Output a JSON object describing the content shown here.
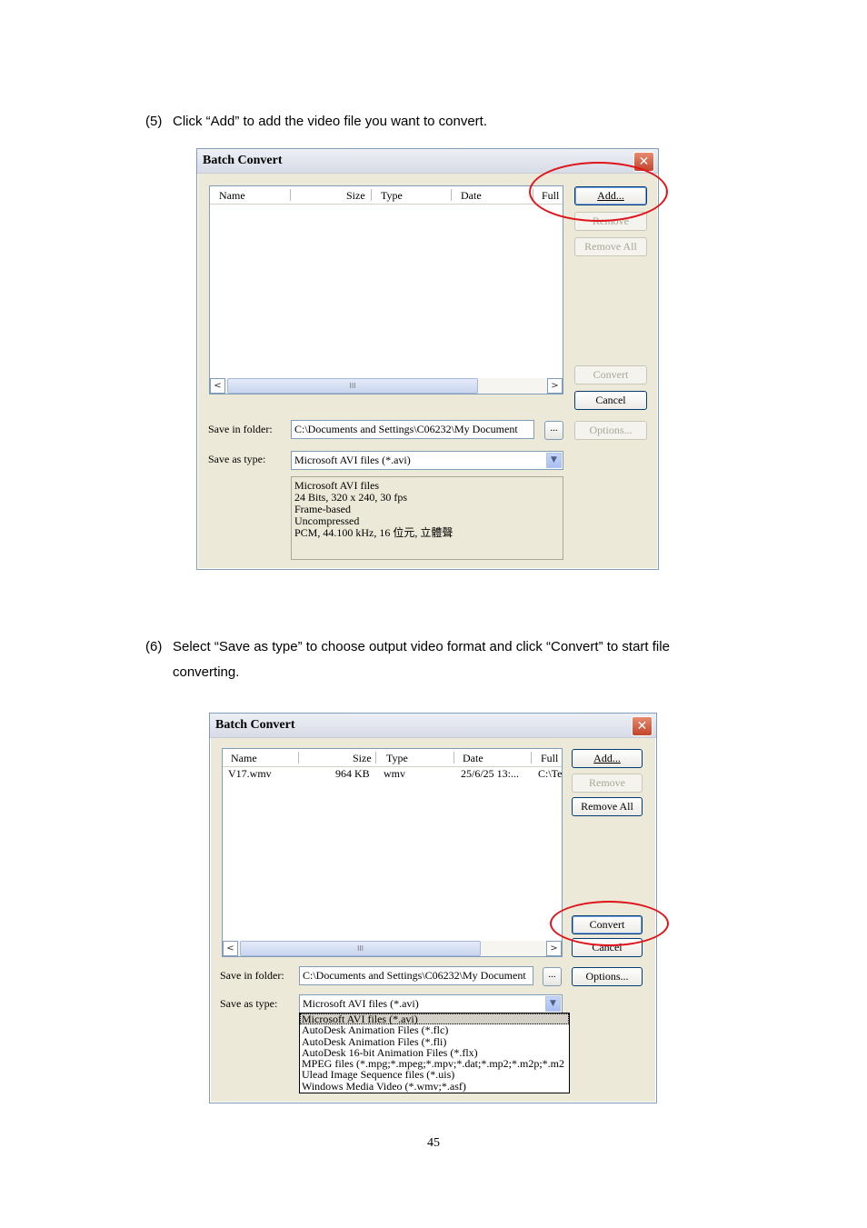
{
  "step5": {
    "number": "(5)",
    "text": "Click “Add” to add the video file you want to convert."
  },
  "step6": {
    "number": "(6)",
    "line1": "Select “Save as type” to choose output video format and click “Convert” to start file",
    "line2": "converting."
  },
  "dialog1": {
    "title": "Batch Convert",
    "columns": [
      "Name",
      "Size",
      "Type",
      "Date",
      "Full"
    ],
    "buttons": {
      "add": "Add...",
      "remove": "Remove",
      "remove_all": "Remove All",
      "convert": "Convert",
      "cancel": "Cancel",
      "options": "Options..."
    },
    "save_in_folder_label": "Save in folder:",
    "save_in_folder_value": "C:\\Documents and Settings\\C06232\\My Document",
    "save_as_type_label": "Save as type:",
    "save_as_type_value": "Microsoft AVI files (*.avi)",
    "info": [
      "Microsoft AVI files",
      "24 Bits, 320 x 240, 30 fps",
      "Frame-based",
      "Uncompressed",
      "PCM, 44.100 kHz, 16 位元, 立體聲"
    ],
    "browse_label": "...",
    "scroll_grip": "III"
  },
  "dialog2": {
    "title": "Batch Convert",
    "columns": [
      "Name",
      "Size",
      "Type",
      "Date",
      "Full"
    ],
    "row": {
      "name": "V17.wmv",
      "size": "964 KB",
      "type": "wmv",
      "date": "25/6/25 13:...",
      "full": "C:\\Te"
    },
    "buttons": {
      "add": "Add...",
      "remove": "Remove",
      "remove_all": "Remove All",
      "convert": "Convert",
      "cancel": "Cancel",
      "options": "Options..."
    },
    "save_in_folder_label": "Save in folder:",
    "save_in_folder_value": "C:\\Documents and Settings\\C06232\\My Document",
    "save_as_type_label": "Save as type:",
    "save_as_type_value": "Microsoft AVI files (*.avi)",
    "dropdown_options": [
      "Microsoft AVI files (*.avi)",
      "AutoDesk Animation Files (*.flc)",
      "AutoDesk Animation Files (*.fli)",
      "AutoDesk 16-bit Animation Files (*.flx)",
      "MPEG files (*.mpg;*.mpeg;*.mpv;*.dat;*.mp2;*.m2p;*.m2",
      "Ulead Image Sequence files (*.uis)",
      "Windows Media Video (*.wmv;*.asf)"
    ],
    "browse_label": "...",
    "scroll_grip": "III"
  },
  "page_number": "45"
}
